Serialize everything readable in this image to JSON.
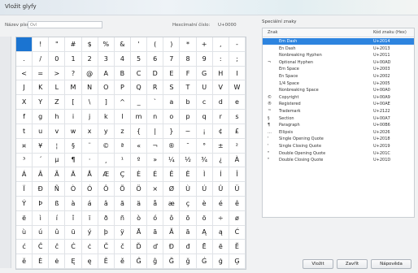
{
  "window": {
    "title": "Vložit glyfy"
  },
  "toolbar": {
    "font_label": "Název písma:",
    "font_value": "Ovl",
    "hex_label": "Hexcímalní číslo:",
    "hex_value": "U+0000"
  },
  "glyph_grid": {
    "rows": [
      [
        " ",
        "!",
        "\"",
        "#",
        "$",
        "%",
        "&",
        "'",
        "(",
        ")",
        "*",
        "+",
        ",",
        "-"
      ],
      [
        ".",
        "/",
        "0",
        "1",
        "2",
        "3",
        "4",
        "5",
        "6",
        "7",
        "8",
        "9",
        ":",
        ";"
      ],
      [
        "<",
        "=",
        ">",
        "?",
        "@",
        "A",
        "B",
        "C",
        "D",
        "E",
        "F",
        "G",
        "H",
        "I"
      ],
      [
        "J",
        "K",
        "L",
        "M",
        "N",
        "O",
        "P",
        "Q",
        "R",
        "S",
        "T",
        "U",
        "V",
        "W"
      ],
      [
        "X",
        "Y",
        "Z",
        "[",
        "\\",
        "]",
        "^",
        "_",
        "`",
        "a",
        "b",
        "c",
        "d",
        "e"
      ],
      [
        "f",
        "g",
        "h",
        "i",
        "j",
        "k",
        "l",
        "m",
        "n",
        "o",
        "p",
        "q",
        "r",
        "s"
      ],
      [
        "t",
        "u",
        "v",
        "w",
        "x",
        "y",
        "z",
        "{",
        "|",
        "}",
        "~",
        "¡",
        "¢",
        "£"
      ],
      [
        "¤",
        "¥",
        "¦",
        "§",
        "¨",
        "©",
        "ª",
        "«",
        "¬",
        "®",
        "¯",
        "°",
        "±",
        "²"
      ],
      [
        "³",
        "´",
        "µ",
        "¶",
        "·",
        "¸",
        "¹",
        "º",
        "»",
        "¼",
        "½",
        "¾",
        "¿",
        "À"
      ],
      [
        "Á",
        "Â",
        "Ã",
        "Ä",
        "Å",
        "Æ",
        "Ç",
        "È",
        "É",
        "Ê",
        "Ë",
        "Ì",
        "Í",
        "Î"
      ],
      [
        "Ï",
        "Ð",
        "Ñ",
        "Ò",
        "Ó",
        "Ô",
        "Õ",
        "Ö",
        "×",
        "Ø",
        "Ù",
        "Ú",
        "Û",
        "Ü"
      ],
      [
        "Ý",
        "Þ",
        "ß",
        "à",
        "á",
        "â",
        "ã",
        "ä",
        "å",
        "æ",
        "ç",
        "è",
        "é",
        "ê"
      ],
      [
        "ë",
        "ì",
        "í",
        "î",
        "ï",
        "ð",
        "ñ",
        "ò",
        "ó",
        "ô",
        "õ",
        "ö",
        "÷",
        "ø"
      ],
      [
        "ù",
        "ú",
        "û",
        "ü",
        "ý",
        "þ",
        "ÿ",
        "Ā",
        "ā",
        "Ă",
        "ă",
        "Ą",
        "ą",
        "Ć"
      ],
      [
        "ć",
        "Ĉ",
        "ĉ",
        "Ċ",
        "ċ",
        "Č",
        "č",
        "Ď",
        "ď",
        "Đ",
        "đ",
        "Ē",
        "ē",
        "Ĕ"
      ],
      [
        "ĕ",
        "Ė",
        "ė",
        "Ę",
        "ę",
        "Ě",
        "ě",
        "Ĝ",
        "ĝ",
        "Ğ",
        "ğ",
        "Ġ",
        "ġ",
        "Ģ"
      ]
    ]
  },
  "special_panel": {
    "label": "Speciální znaky",
    "col_glyph": "Znak",
    "col_key": "Kód znaku (Hex)",
    "rows": [
      {
        "glyph": "",
        "name": "Em Dash",
        "key": "U+2014",
        "selected": true
      },
      {
        "glyph": "",
        "name": "En Dash",
        "key": "U+2013",
        "selected": false
      },
      {
        "glyph": "",
        "name": "Nonbreaking Hyphen",
        "key": "U+2011",
        "selected": false
      },
      {
        "glyph": "¬",
        "name": "Optional Hyphen",
        "key": "U+00AD",
        "selected": false
      },
      {
        "glyph": "",
        "name": "Em Space",
        "key": "U+2003",
        "selected": false
      },
      {
        "glyph": "",
        "name": "En Space",
        "key": "U+2002",
        "selected": false
      },
      {
        "glyph": "",
        "name": "1/4 Space",
        "key": "U+2005",
        "selected": false
      },
      {
        "glyph": "",
        "name": "Nonbreaking Space",
        "key": "U+00A0",
        "selected": false
      },
      {
        "glyph": "©",
        "name": "Copyright",
        "key": "U+00A9",
        "selected": false
      },
      {
        "glyph": "®",
        "name": "Registered",
        "key": "U+00AE",
        "selected": false
      },
      {
        "glyph": "™",
        "name": "Trademark",
        "key": "U+2122",
        "selected": false
      },
      {
        "glyph": "§",
        "name": "Section",
        "key": "U+00A7",
        "selected": false
      },
      {
        "glyph": "¶",
        "name": "Paragraph",
        "key": "U+00B6",
        "selected": false
      },
      {
        "glyph": "…",
        "name": "Ellipsis",
        "key": "U+2026",
        "selected": false
      },
      {
        "glyph": "'",
        "name": "Single Opening Quote",
        "key": "U+2018",
        "selected": false
      },
      {
        "glyph": "'",
        "name": "Single Closing Quote",
        "key": "U+2019",
        "selected": false
      },
      {
        "glyph": "\"",
        "name": "Double Opening Quote",
        "key": "U+201C",
        "selected": false
      },
      {
        "glyph": "\"",
        "name": "Double Closing Quote",
        "key": "U+201D",
        "selected": false
      }
    ]
  },
  "buttons": {
    "insert": "Vložit",
    "close": "Zavřít",
    "help": "Nápověda"
  }
}
